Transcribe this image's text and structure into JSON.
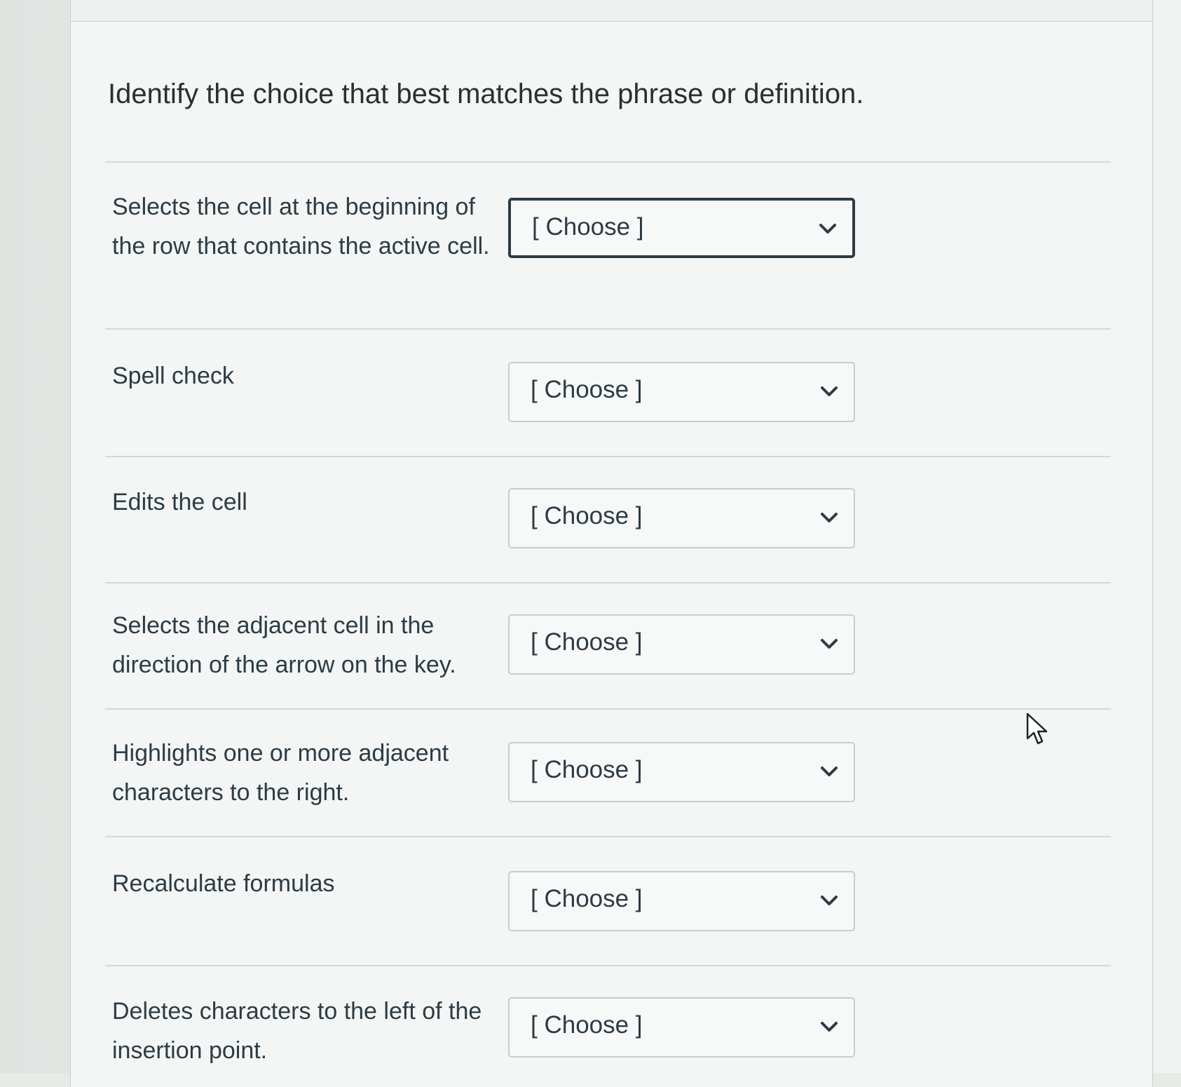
{
  "question": {
    "prompt": "Identify the choice that best matches the phrase or definition."
  },
  "matches": [
    {
      "label": "Selects the cell at the beginning of the row that contains the active cell.",
      "selected": "[ Choose ]"
    },
    {
      "label": "Spell check",
      "selected": "[ Choose ]"
    },
    {
      "label": "Edits the cell",
      "selected": "[ Choose ]"
    },
    {
      "label": "Selects the adjacent cell in the direction of the arrow on the key.",
      "selected": "[ Choose ]"
    },
    {
      "label": "Highlights one or more adjacent characters to the right.",
      "selected": "[ Choose ]"
    },
    {
      "label": "Recalculate formulas",
      "selected": "[ Choose ]"
    },
    {
      "label": "Deletes characters to the left of the insertion point.",
      "selected": "[ Choose ]"
    }
  ],
  "icons": {
    "dropdown": "chevron-down-icon",
    "pointer": "mouse-pointer-icon"
  },
  "colors": {
    "text": "#2d3b45",
    "focus_border": "#2d3b45",
    "select_border": "#c7cdd1"
  }
}
